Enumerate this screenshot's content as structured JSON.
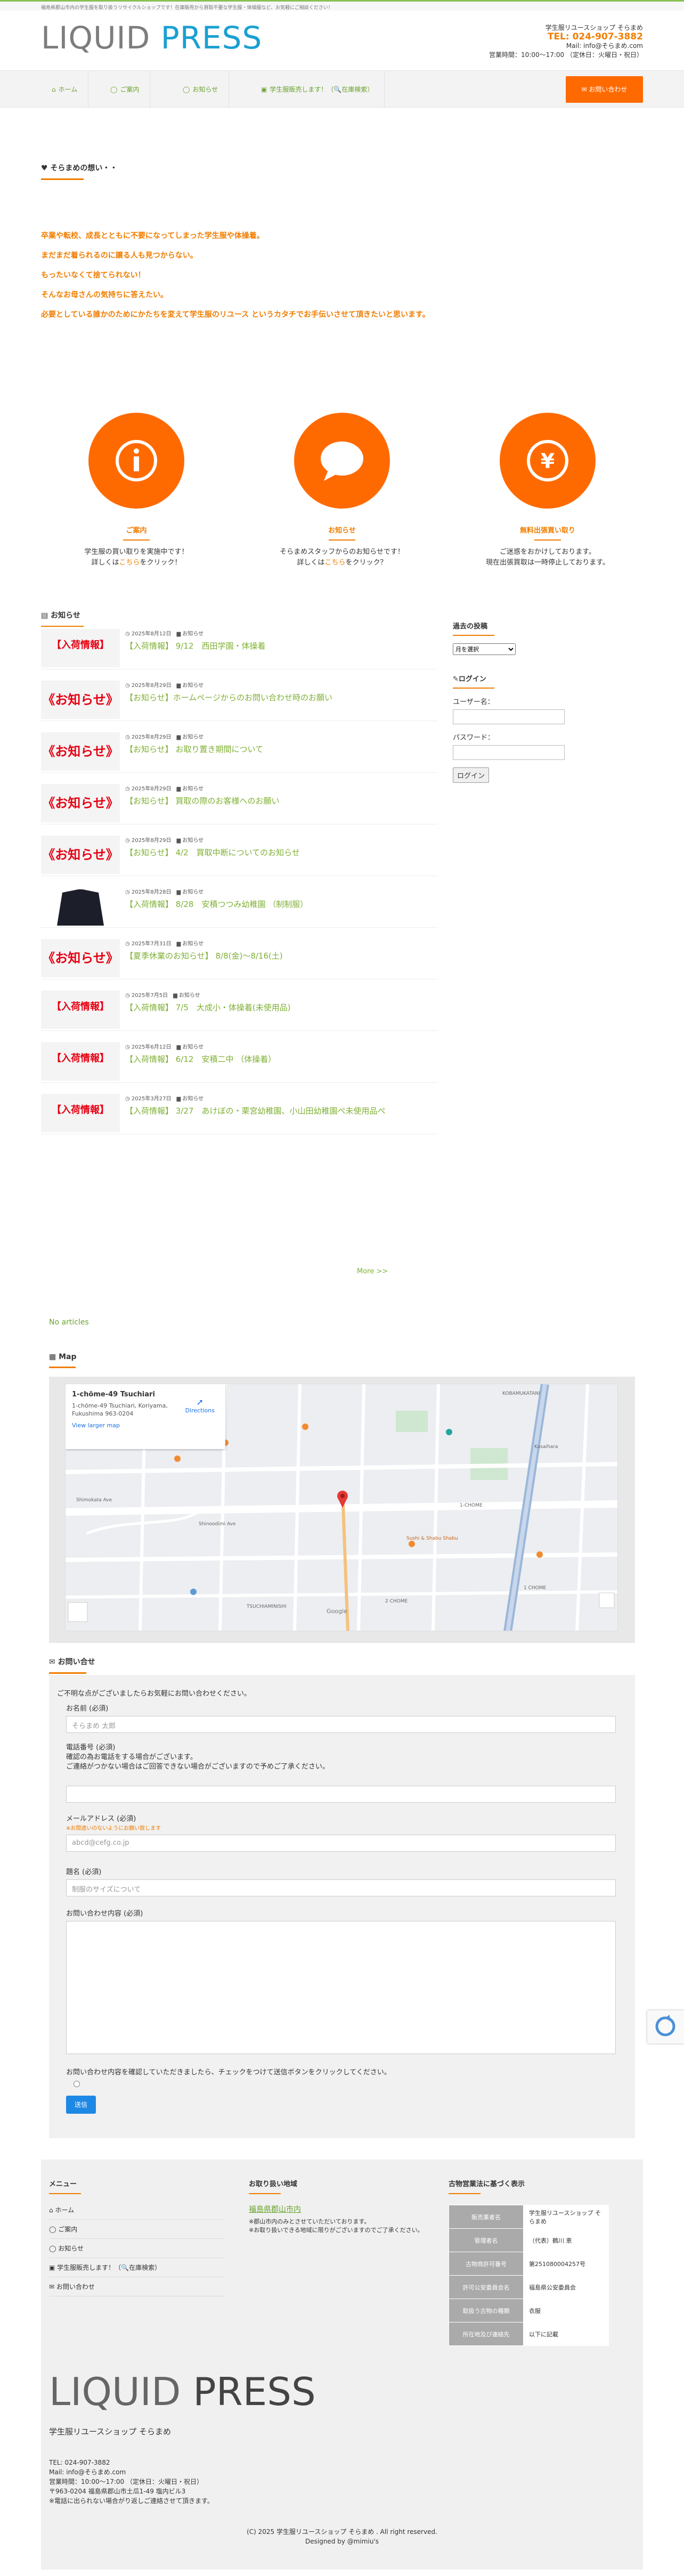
{
  "topbar": {
    "text": "福島県郡山市内の学生服を取り扱うリサイクルショップです！在庫販売から買取不要な学生服・体操服など、お気軽にご相談ください！"
  },
  "logo": {
    "part1": "LIQUID",
    "part2": "PRESS"
  },
  "header": {
    "shop": "学生服リユースショップ そらまめ",
    "tel": "TEL: 024-907-3882",
    "mail": "Mail: info@そらまめ.com",
    "hours": "営業時間：10:00〜17:00 （定休日：火曜日・祝日）"
  },
  "nav": {
    "items": [
      {
        "icon": "⌂",
        "label": "ホーム"
      },
      {
        "icon": "◯",
        "label": "ご案内"
      },
      {
        "icon": "◯",
        "label": "お知らせ"
      },
      {
        "icon": "▣",
        "label": "学生服販売します！（🔍在庫検索）"
      }
    ],
    "contact": "お問い合わせ"
  },
  "omoi": {
    "heading": "そらまめの想い・・",
    "lines": [
      "卒業や転校、成長とともに不要になってしまった学生服や体操着。",
      "まだまだ着られるのに譲る人も見つからない。",
      "もったいなくて捨てられない！",
      "そんなお母さんの気持ちに答えたい。",
      "必要としている誰かのためにかたちを変えて学生服のリユース というカタチでお手伝いさせて頂きたいと思います。"
    ]
  },
  "features": [
    {
      "icon": "info-icon",
      "glyph": "i",
      "title": "ご案内",
      "desc1": "学生服の買い取りを実施中です！",
      "desc2a": "詳しくは",
      "desc2b": "こちら",
      "desc2c": "をクリック！"
    },
    {
      "icon": "speech-bubble-icon",
      "glyph": "",
      "title": "お知らせ",
      "desc1": "そらまめスタッフからのお知らせです！",
      "desc2a": "詳しくは",
      "desc2b": "こちら",
      "desc2c": "をクリック？"
    },
    {
      "icon": "yen-icon",
      "glyph": "¥",
      "title": "無料出張買い取り",
      "desc1": "ご迷惑をおかけしております。",
      "desc2a": "現在出張買取は一時停止しております。",
      "desc2b": "",
      "desc2c": ""
    }
  ],
  "news": {
    "heading": "お知らせ",
    "items": [
      {
        "thumb": "nyuka",
        "thumb_label": "【入荷情報】",
        "date": "2025年8月12日",
        "cat": "お知らせ",
        "title": "【入荷情報】 9/12　西田学園・体操着"
      },
      {
        "thumb": "oshirase",
        "thumb_label": "《お知らせ》",
        "date": "2025年8月29日",
        "cat": "お知らせ",
        "title": "【お知らせ】ホームページからのお問い合わせ時のお願い"
      },
      {
        "thumb": "oshirase",
        "thumb_label": "《お知らせ》",
        "date": "2025年8月29日",
        "cat": "お知らせ",
        "title": "【お知らせ】 お取り置き期間について"
      },
      {
        "thumb": "oshirase",
        "thumb_label": "《お知らせ》",
        "date": "2025年8月29日",
        "cat": "お知らせ",
        "title": "【お知らせ】 買取の際のお客様へのお願い"
      },
      {
        "thumb": "oshirase",
        "thumb_label": "《お知らせ》",
        "date": "2025年8月29日",
        "cat": "お知らせ",
        "title": "【お知らせ】 4/2　買取中断についてのお知らせ"
      },
      {
        "thumb": "photo",
        "thumb_label": "",
        "date": "2025年8月28日",
        "cat": "お知らせ",
        "title": "【入荷情報】 8/28　安積つつみ幼稚園 （制制服）"
      },
      {
        "thumb": "oshirase",
        "thumb_label": "《お知らせ》",
        "date": "2025年7月31日",
        "cat": "お知らせ",
        "title": "【夏季休業のお知らせ】 8/8(金)〜8/16(土)"
      },
      {
        "thumb": "nyuka",
        "thumb_label": "【入荷情報】",
        "date": "2025年7月5日",
        "cat": "お知らせ",
        "title": "【入荷情報】 7/5　大成小・体操着(未使用品)"
      },
      {
        "thumb": "nyuka",
        "thumb_label": "【入荷情報】",
        "date": "2025年6月12日",
        "cat": "お知らせ",
        "title": "【入荷情報】 6/12　安積二中 （体操着）"
      },
      {
        "thumb": "nyuka",
        "thumb_label": "【入荷情報】",
        "date": "2025年3月27日",
        "cat": "お知らせ",
        "title": "【入荷情報】 3/27　あけぼの・栗宮幼稚園、小山田幼稚園ぺ未使用品ぺ"
      }
    ],
    "more": "More >>"
  },
  "sidebar": {
    "archive_head": "過去の投稿",
    "archive_select": "月を選択",
    "login_head": "ログイン",
    "user_label": "ユーザー名：",
    "pass_label": "パスワード：",
    "login_btn": "ログイン"
  },
  "noart": "No articles",
  "map": {
    "heading": "Map",
    "place": "1-chōme-49 Tsuchiari",
    "addr1": "1-chōme-49 Tsuchiari, Koriyama,",
    "addr2": "Fukushima 963-0204",
    "view": "View larger map",
    "dir": "Directions",
    "labels": [
      "TSUCHIAMINISHI",
      "KOBAMUKATANI",
      "Kasaihara",
      "1-CHOME",
      "Shimokata Ave",
      "Shinoodimi Ave",
      "Sushi & Shabu Shabu",
      "2 CHOME",
      "1 CHOME",
      "Google"
    ]
  },
  "form": {
    "heading": "お問い合せ",
    "intro": "ご不明な点がございましたらお気軽にお問い合わせください。",
    "name_label": "お名前 (必須)",
    "name_ph": "そらまめ 太郎",
    "phone_label": "電話番号 (必須)",
    "phone_note1": "確認の為お電話をする場合がございます。",
    "phone_note2": "ご連絡がつかない場合はご回答できない場合がございますので予めご了承ください。",
    "email_label": "メールアドレス (必須)",
    "email_note": "※お間違いのないようにお願い致します",
    "email_ph": "abcd@cefg.co.jp",
    "subject_label": "題名 (必須)",
    "subject_ph": "制服のサイズについて",
    "msg_label": "お問い合わせ内容 (必須)",
    "confirm": "お問い合わせ内容を確認していただきましたら、チェックをつけて送信ボタンをクリックしてください。",
    "send": "送信"
  },
  "footer": {
    "menu_head": "メニュー",
    "menu": [
      "ホーム",
      "ご案内",
      "お知らせ",
      "学生服販売します！（🔍在庫検索）",
      "お問い合わせ"
    ],
    "area_head": "お取り扱い地域",
    "area_title": "福島県郡山市内",
    "area_text": "※郡山市内のみとさせていただいております。",
    "area_text2": "※お取り扱いできる地域に限りがございますのでご了承ください。",
    "kobu_head": "古物営業法に基づく表示",
    "kobu": [
      [
        "販売業者名",
        "学生服リユースショップ そらまめ"
      ],
      [
        "管理者名",
        "（代表）鶴川 恵"
      ],
      [
        "古物商許可番号",
        "第251080004257号"
      ],
      [
        "許可公安委員会名",
        "福島県公安委員会"
      ],
      [
        "取扱う古物の種類",
        "衣服"
      ],
      [
        "所在地及び連絡先",
        "以下に記載"
      ]
    ],
    "logo1": "LIQUID",
    "logo2": "PRESS",
    "shop": "学生服リユースショップ そらまめ",
    "addr": [
      "TEL: 024-907-3882",
      "Mail: info@そらまめ.com",
      "営業時間：10:00〜17:00 （定休日：火曜日・祝日）",
      "〒963-0204 福島県郡山市土瓜1-49 塩内ビル3",
      "※電話に出られない場合がり返しご連絡させて頂きます。"
    ],
    "copy1": "(C) 2025 学生服リユースショップ そらまめ . All right reserved.",
    "copy2": "Designed by @mimiu's"
  },
  "colors": {
    "accent": "#f07d00",
    "green": "#7fb034",
    "brand": "#1aa0d2"
  }
}
